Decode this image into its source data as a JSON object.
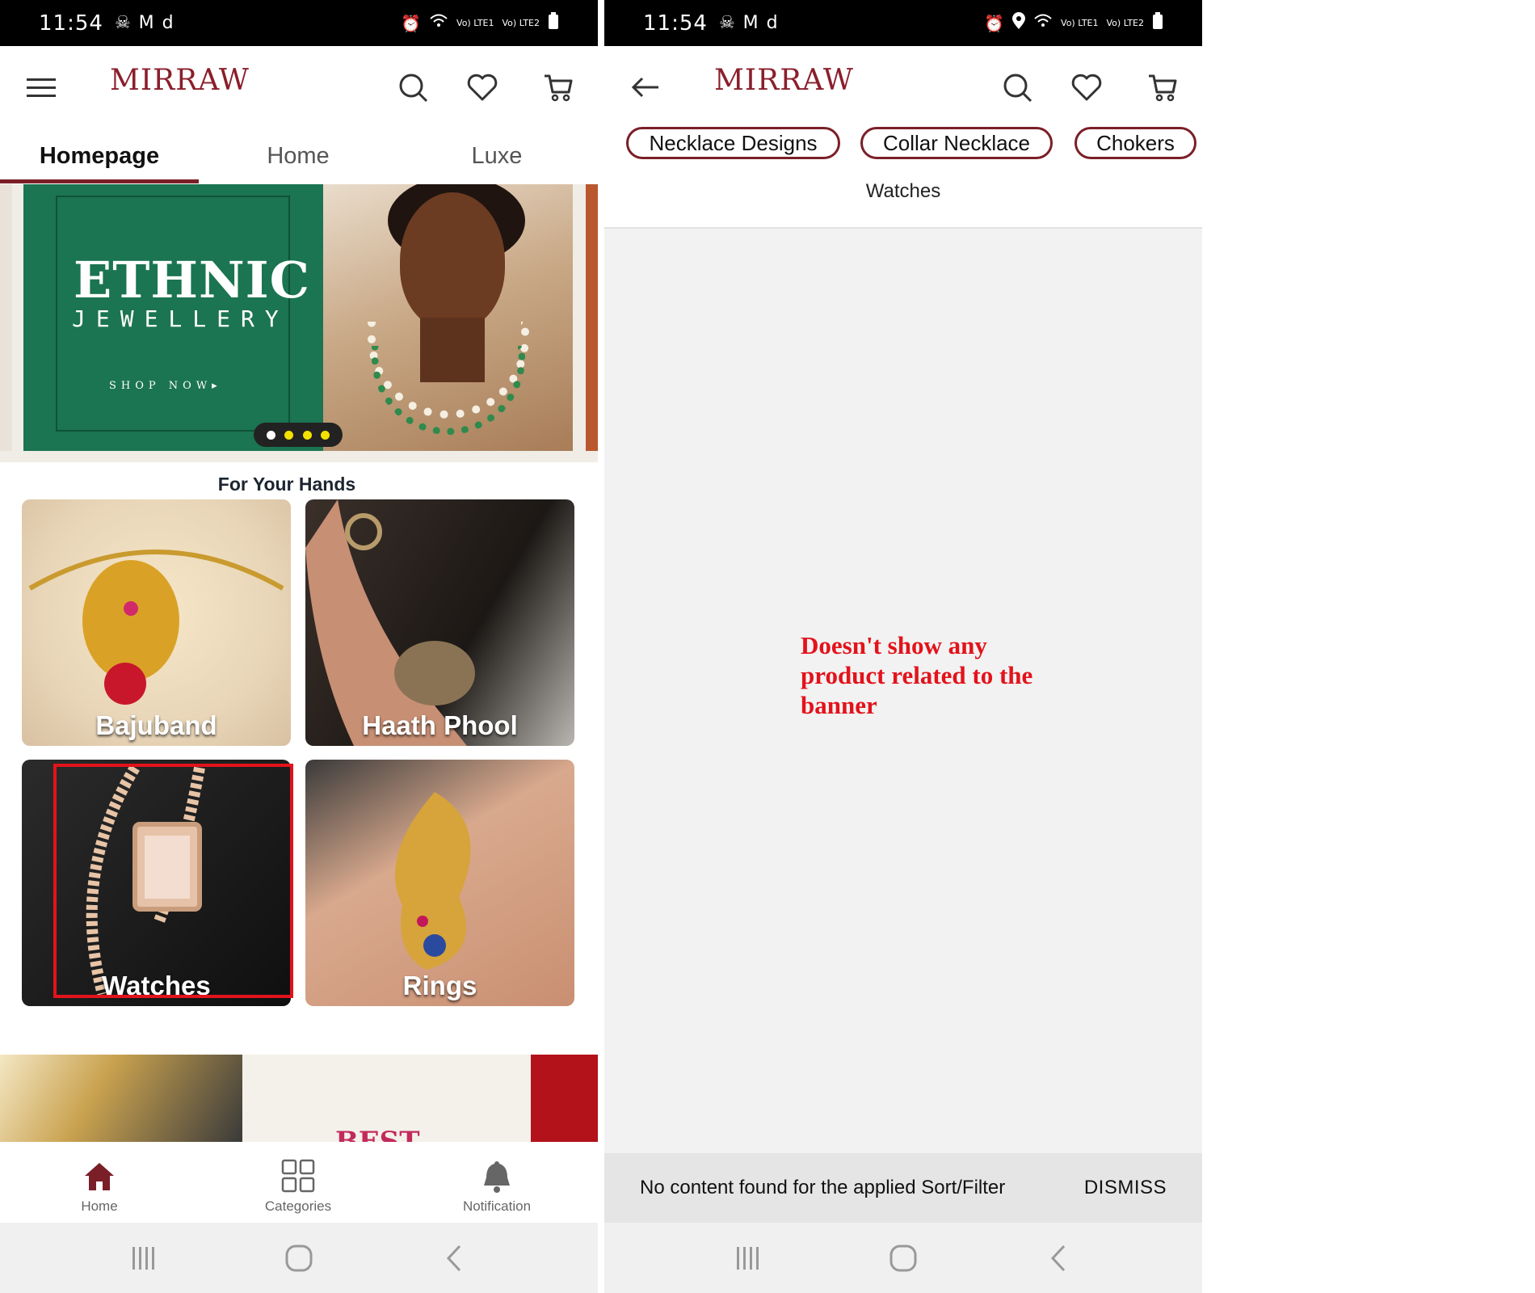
{
  "left": {
    "status_bar": {
      "time": "11:54",
      "left_icons": [
        "☠",
        "M",
        "d"
      ],
      "right_icons": [
        "⏰",
        "Vo) LTE1",
        "Vo) LTE2"
      ]
    },
    "app": {
      "logo": "MIRRAW"
    },
    "tabs": [
      {
        "label": "Homepage",
        "active": true
      },
      {
        "label": "Home",
        "active": false
      },
      {
        "label": "Luxe",
        "active": false
      }
    ],
    "banner": {
      "title": "ETHNIC",
      "subtitle": "JEWELLERY",
      "cta": "SHOP NOW▸",
      "dots": 4,
      "current": 0
    },
    "section_title": "For Your Hands",
    "tiles": [
      {
        "label": "Bajuband"
      },
      {
        "label": "Haath Phool"
      },
      {
        "label": "Watches"
      },
      {
        "label": "Rings"
      }
    ],
    "strip_text": "BEST",
    "bottom_nav": [
      {
        "label": "Home",
        "icon": "home-icon"
      },
      {
        "label": "Categories",
        "icon": "grid-icon"
      },
      {
        "label": "Notification",
        "icon": "bell-icon"
      }
    ]
  },
  "right": {
    "status_bar": {
      "time": "11:54",
      "left_icons": [
        "☠",
        "M",
        "d"
      ],
      "right_icons": [
        "⏰",
        "📍",
        "Vo) LTE1",
        "Vo) LTE2"
      ]
    },
    "app": {
      "logo": "MIRRAW"
    },
    "chips": [
      "Necklace Designs",
      "Collar Necklace",
      "Chokers"
    ],
    "chip_second_row": "Watches",
    "annotation": "Doesn't show any product related to the banner",
    "snackbar": {
      "message": "No content found for the applied Sort/Filter",
      "action": "DISMISS"
    }
  },
  "colors": {
    "brand": "#7a1f28",
    "banner_green": "#1b7452",
    "annotation_red": "#e3131b",
    "status_bar": "#000000"
  }
}
